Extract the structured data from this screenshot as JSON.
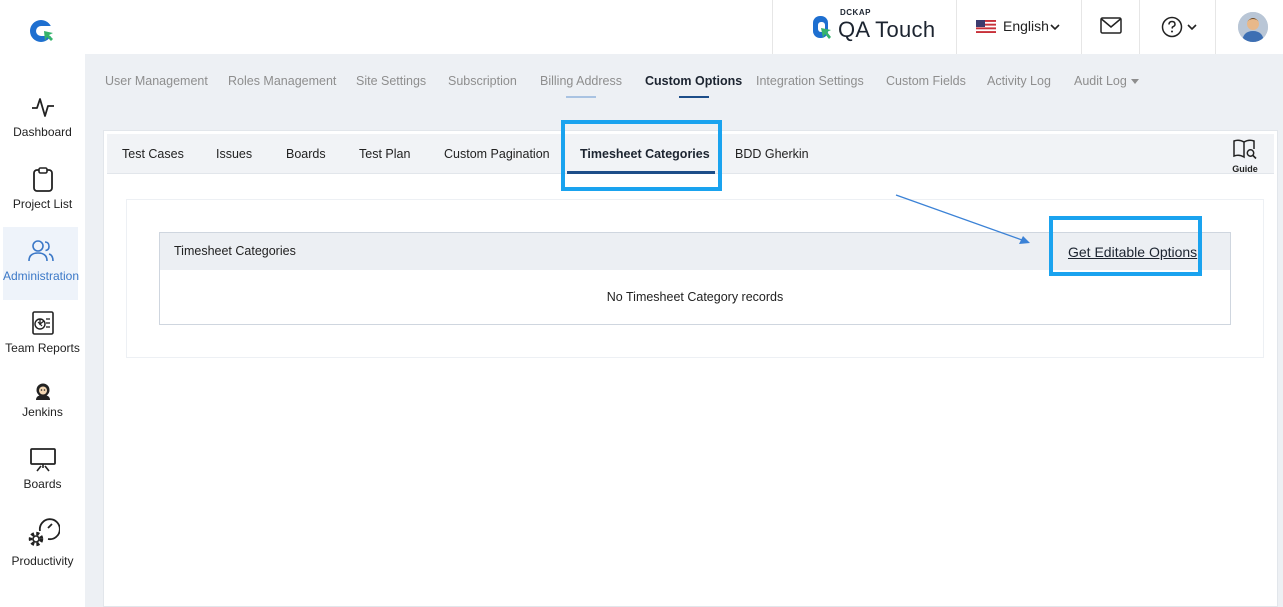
{
  "header": {
    "brand_small": "DCKAP",
    "brand_name": "QA Touch",
    "language": "English"
  },
  "sidebar": {
    "items": [
      {
        "label": "Dashboard",
        "icon": "pulse-icon",
        "active": false
      },
      {
        "label": "Project List",
        "icon": "clipboard-icon",
        "active": false
      },
      {
        "label": "Administration",
        "icon": "users-icon",
        "active": true
      },
      {
        "label": "Team Reports",
        "icon": "report-icon",
        "active": false
      },
      {
        "label": "Jenkins",
        "icon": "jenkins-icon",
        "active": false
      },
      {
        "label": "Boards",
        "icon": "presentation-board-icon",
        "active": false
      },
      {
        "label": "Productivity",
        "icon": "gear-gauge-icon",
        "active": false
      }
    ]
  },
  "admin_tabs": [
    {
      "label": "User Management"
    },
    {
      "label": "Roles Management"
    },
    {
      "label": "Site Settings"
    },
    {
      "label": "Subscription"
    },
    {
      "label": "Billing Address"
    },
    {
      "label": "Custom Options",
      "active": true
    },
    {
      "label": "Integration Settings"
    },
    {
      "label": "Custom Fields"
    },
    {
      "label": "Activity Log"
    },
    {
      "label": "Audit Log"
    }
  ],
  "sub_tabs": [
    {
      "label": "Test Cases"
    },
    {
      "label": "Issues"
    },
    {
      "label": "Boards"
    },
    {
      "label": "Test Plan"
    },
    {
      "label": "Custom Pagination"
    },
    {
      "label": "Timesheet Categories",
      "active": true
    },
    {
      "label": "BDD Gherkin"
    }
  ],
  "guide_label": "Guide",
  "table": {
    "title": "Timesheet Categories",
    "action_link": "Get Editable Options",
    "empty_message": "No Timesheet Category records"
  },
  "colors": {
    "accent": "#1d4e89",
    "highlight": "#1aa3ef",
    "active_nav": "#3b78c7",
    "background": "#edf0f4"
  }
}
